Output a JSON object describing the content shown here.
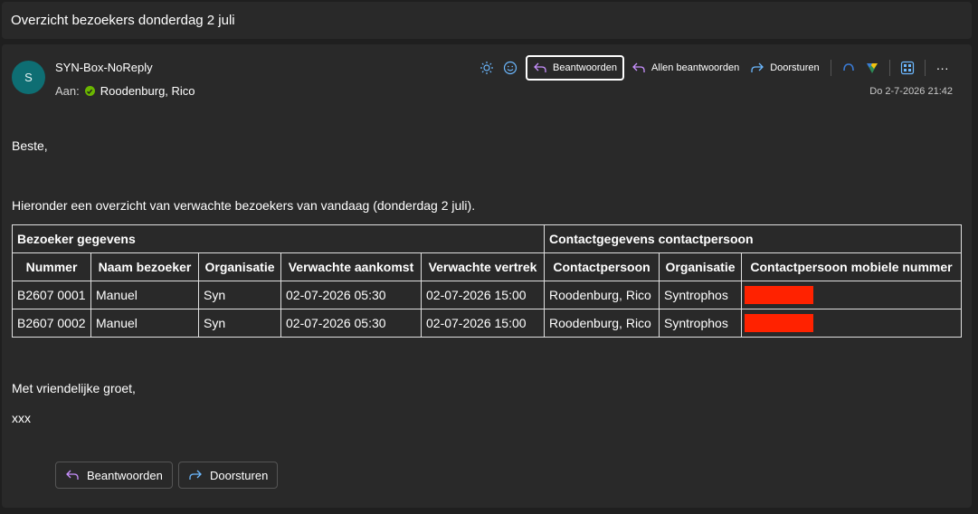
{
  "subject": "Overzicht bezoekers donderdag 2 juli",
  "sender": {
    "initial": "S",
    "name": "SYN-Box-NoReply",
    "to_label": "Aan:",
    "to_name": "Roodenburg, Rico",
    "date": "Do 2-7-2026 21:42"
  },
  "toolbar": {
    "reply": "Beantwoorden",
    "reply_all": "Allen beantwoorden",
    "forward": "Doorsturen",
    "more": "···"
  },
  "body": {
    "greeting": "Beste,",
    "intro": "Hieronder een overzicht van verwachte bezoekers van vandaag (donderdag 2 juli).",
    "closing": "Met vriendelijke groet,",
    "signature": "xxx"
  },
  "table": {
    "group_visitor": "Bezoeker gegevens",
    "group_contact": "Contactgegevens contactpersoon",
    "headers": [
      "Nummer",
      "Naam bezoeker",
      "Organisatie",
      "Verwachte aankomst",
      "Verwachte vertrek",
      "Contactpersoon",
      "Organisatie",
      "Contactpersoon mobiele nummer"
    ],
    "rows": [
      [
        "B2607 0001",
        "Manuel",
        "Syn",
        "02-07-2026 05:30",
        "02-07-2026 15:00",
        "Roodenburg, Rico",
        "Syntrophos"
      ],
      [
        "B2607 0002",
        "Manuel",
        "Syn",
        "02-07-2026 05:30",
        "02-07-2026 15:00",
        "Roodenburg, Rico",
        "Syntrophos"
      ]
    ]
  },
  "actions": {
    "reply": "Beantwoorden",
    "forward": "Doorsturen"
  },
  "colors": {
    "avatar": "#0e6e73",
    "reply_arrow": "#c890ff",
    "forward_arrow": "#6cb8ff",
    "presence": "#6bb700",
    "redaction": "#ff2200"
  }
}
